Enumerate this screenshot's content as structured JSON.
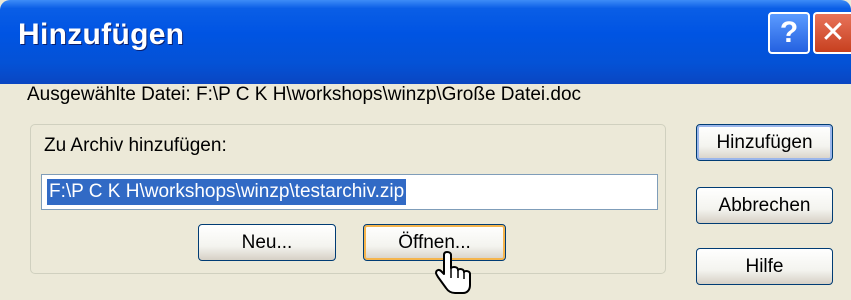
{
  "window": {
    "title": "Hinzufügen",
    "help_glyph": "?",
    "close_glyph": "✕"
  },
  "info": {
    "selected_file": "Ausgewählte Datei: F:\\P C K H\\workshops\\winzp\\Große Datei.doc"
  },
  "archive": {
    "label": "Zu Archiv hinzufügen:",
    "path_value": "F:\\P C K H\\workshops\\winzp\\testarchiv.zip",
    "new_button": "Neu...",
    "open_button": "Öffnen..."
  },
  "side_buttons": {
    "add": "Hinzufügen",
    "cancel": "Abbrechen",
    "help": "Hilfe"
  },
  "icons": {
    "help": "question-icon",
    "close": "close-icon",
    "cursor": "mouse-cursor-icon"
  },
  "colors": {
    "title_bar": "#0054e3",
    "dialog_bg": "#ece9d8",
    "selection": "#316ac5",
    "close_button": "#c7401f"
  }
}
